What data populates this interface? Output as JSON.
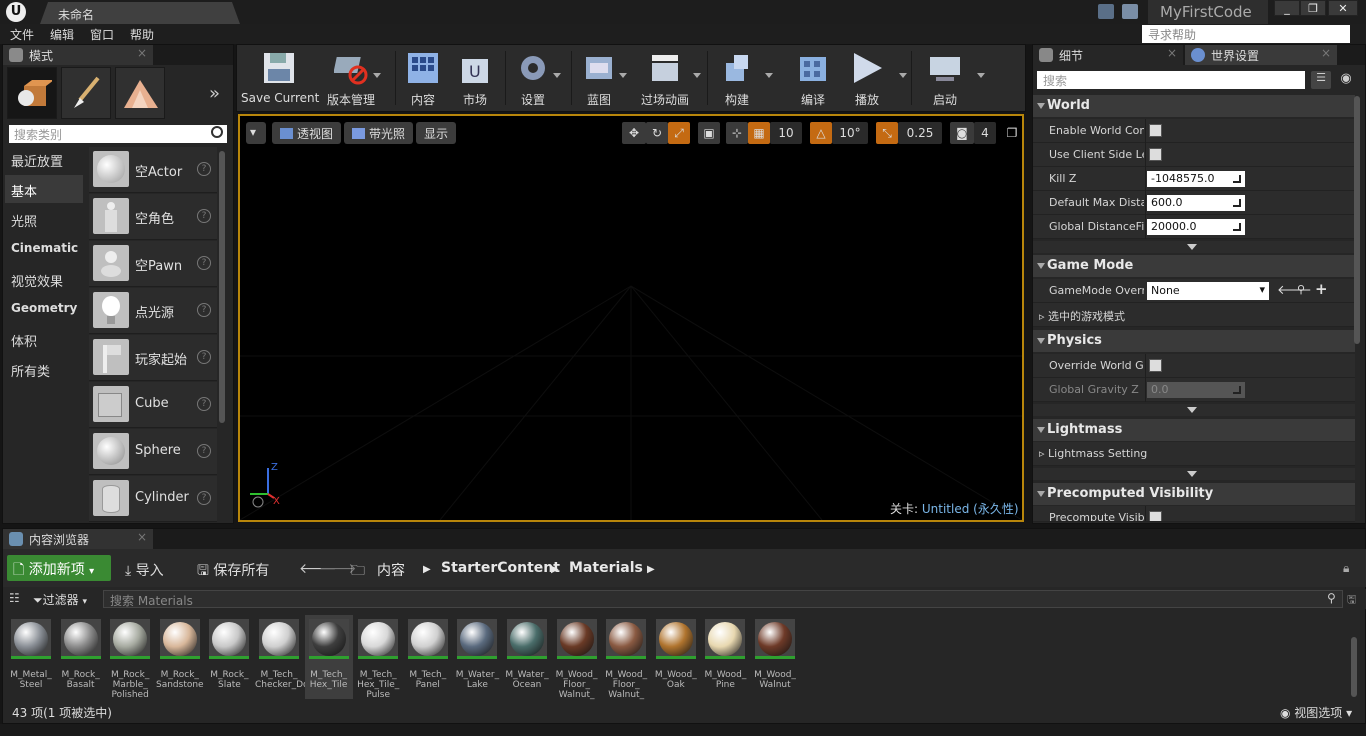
{
  "window": {
    "doc_tab": "未命名",
    "project": "MyFirstCode",
    "min": "_",
    "max": "❐",
    "close": "✕"
  },
  "menu": [
    "文件",
    "编辑",
    "窗口",
    "帮助"
  ],
  "help_search_placeholder": "寻求帮助",
  "modes": {
    "tab": "模式",
    "search_placeholder": "搜索类别",
    "categories": [
      {
        "label": "最近放置",
        "bold": false
      },
      {
        "label": "基本",
        "bold": false
      },
      {
        "label": "光照",
        "bold": false
      },
      {
        "label": "Cinematic",
        "bold": true
      },
      {
        "label": "视觉效果",
        "bold": false
      },
      {
        "label": "Geometry",
        "bold": true
      },
      {
        "label": "体积",
        "bold": false
      },
      {
        "label": "所有类",
        "bold": false
      }
    ],
    "items": [
      "空Actor",
      "空角色",
      "空Pawn",
      "点光源",
      "玩家起始",
      "Cube",
      "Sphere",
      "Cylinder"
    ]
  },
  "toolbar": [
    "Save Current",
    "版本管理",
    "内容",
    "市场",
    "设置",
    "蓝图",
    "过场动画",
    "构建",
    "编译",
    "播放",
    "启动"
  ],
  "viewport": {
    "perspective": "透视图",
    "lit": "带光照",
    "show": "显示",
    "grid": "10",
    "angle": "10°",
    "scale": "0.25",
    "speed": "4",
    "level_label": "关卡:",
    "level_name": "Untitled (永久性)"
  },
  "details": {
    "tab1": "细节",
    "tab2": "世界设置",
    "search_placeholder": "搜索",
    "world": {
      "title": "World",
      "rows": [
        {
          "label": "Enable World Comp",
          "type": "check"
        },
        {
          "label": "Use Client Side Le",
          "type": "check"
        },
        {
          "label": "Kill Z",
          "value": "-1048575.0"
        },
        {
          "label": "Default Max Distar",
          "value": "600.0"
        },
        {
          "label": "Global DistanceFie",
          "value": "20000.0"
        }
      ]
    },
    "gamemode": {
      "title": "Game Mode",
      "override_label": "GameMode Overri",
      "override_value": "None",
      "selected_label": "选中的游戏模式"
    },
    "physics": {
      "title": "Physics",
      "override_label": "Override World Gra",
      "gravity_label": "Global Gravity Z",
      "gravity_value": "0.0"
    },
    "lightmass": {
      "title": "Lightmass",
      "settings_label": "Lightmass Setting"
    },
    "precomputed": {
      "title": "Precomputed Visibility",
      "row_label": "Precompute Visibi"
    }
  },
  "content_browser": {
    "tab": "内容浏览器",
    "add_new": "添加新项",
    "import": "导入",
    "save_all": "保存所有",
    "crumbs": [
      "内容",
      "StarterContent",
      "Materials"
    ],
    "filters": "过滤器",
    "search_placeholder": "搜索 Materials",
    "assets": [
      {
        "name": "M_Metal_\nSteel",
        "color": "#8a8f96"
      },
      {
        "name": "M_Rock_\nBasalt",
        "color": "#8c8c8c"
      },
      {
        "name": "M_Rock_\nMarble_\nPolished",
        "color": "#a6aaa0"
      },
      {
        "name": "M_Rock_\nSandstone",
        "color": "#d8b79a"
      },
      {
        "name": "M_Rock_\nSlate",
        "color": "#c8c8c8"
      },
      {
        "name": "M_Tech_\nChecker_Dot",
        "color": "#cfcfcf"
      },
      {
        "name": "M_Tech_\nHex_Tile",
        "color": "#3e3e3e"
      },
      {
        "name": "M_Tech_\nHex_Tile_\nPulse",
        "color": "#d8d8d8"
      },
      {
        "name": "M_Tech_\nPanel",
        "color": "#d0d0d0"
      },
      {
        "name": "M_Water_\nLake",
        "color": "#5a6a7e"
      },
      {
        "name": "M_Water_\nOcean",
        "color": "#4a6d6a"
      },
      {
        "name": "M_Wood_\nFloor_\nWalnut_",
        "color": "#6a3a26"
      },
      {
        "name": "M_Wood_\nFloor_\nWalnut_",
        "color": "#8a5a42"
      },
      {
        "name": "M_Wood_\nOak",
        "color": "#b0742e"
      },
      {
        "name": "M_Wood_\nPine",
        "color": "#e8d8b0"
      },
      {
        "name": "M_Wood_\nWalnut",
        "color": "#6e3a28"
      }
    ],
    "selected_index": 6,
    "count": "43 项(1 项被选中)",
    "view_options": "视图选项"
  }
}
